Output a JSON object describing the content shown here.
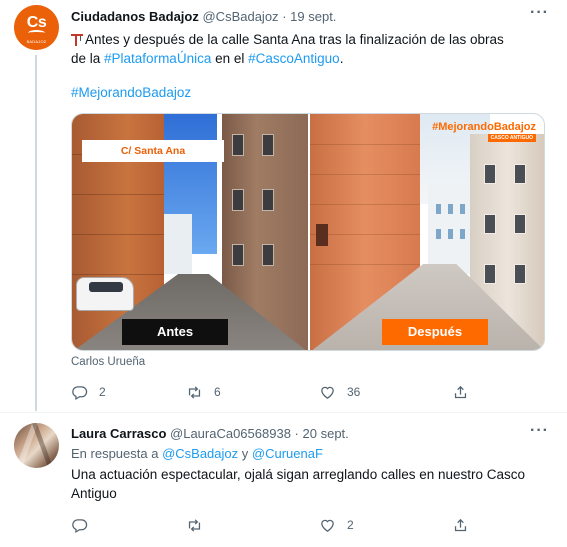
{
  "tweets": [
    {
      "name": "Ciudadanos Badajoz",
      "handle": "@CsBadajoz",
      "separator": "·",
      "date": "19 sept.",
      "avatar_text": "Cs",
      "avatar_subtext": "BADAJOZ",
      "body_line1": "Antes y después de la calle Santa Ana tras la finalización de las obras",
      "body_line2_prefix": "de la ",
      "hashtag1": "#PlataformaÚnica",
      "body_line2_mid": " en el ",
      "hashtag2": "#CascoAntiguo",
      "body_line2_suffix": ".",
      "hashtag3": "#MejorandoBadajoz",
      "media": {
        "label_street": "C/ Santa Ana",
        "label_before": "Antes",
        "label_after": "Después",
        "tag": "#MejorandoBadajoz",
        "tag_sub": "CASCO ANTIGUO"
      },
      "credit": "Carlos Urueña",
      "counts": {
        "reply": "2",
        "retweet": "6",
        "like": "36"
      }
    },
    {
      "name": "Laura Carrasco",
      "handle": "@LauraCa06568938",
      "separator": "·",
      "date": "20 sept.",
      "reply_prefix": "En respuesta a ",
      "reply_user1": "@CsBadajoz",
      "reply_join": " y ",
      "reply_user2": "@CuruenaF",
      "body_line1": "Una actuación espectacular, ojalá sigan arreglando calles en nuestro Casco",
      "body_line2": "Antiguo",
      "counts": {
        "reply": "",
        "retweet": "",
        "like": "2"
      }
    }
  ],
  "more_label": "···",
  "colors": {
    "link": "#1d9bf0",
    "brand_orange": "#eb6109",
    "text_secondary": "#536471"
  },
  "icons": [
    "reply-icon",
    "retweet-icon",
    "like-icon",
    "share-icon",
    "more-icon",
    "crane-emoji-icon"
  ]
}
